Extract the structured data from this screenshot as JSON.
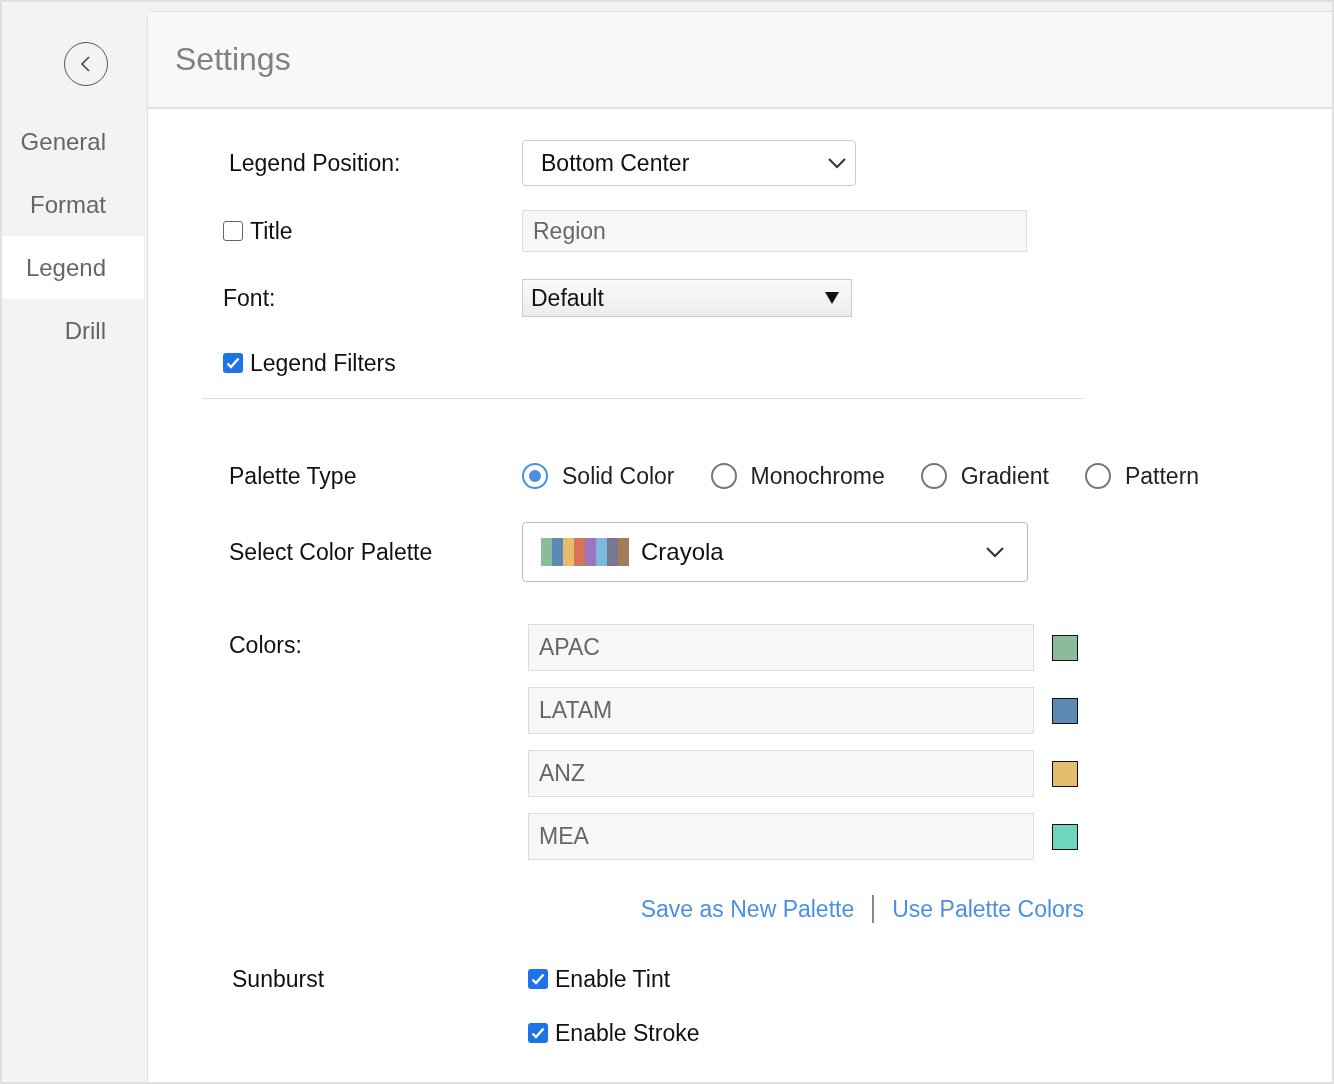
{
  "sidebar": {
    "items": [
      {
        "label": "General",
        "selected": false
      },
      {
        "label": "Format",
        "selected": false
      },
      {
        "label": "Legend",
        "selected": true
      },
      {
        "label": "Drill",
        "selected": false
      }
    ]
  },
  "header": {
    "title": "Settings"
  },
  "legend": {
    "position": {
      "label": "Legend Position:",
      "value": "Bottom Center"
    },
    "title": {
      "label": "Title",
      "checked": false,
      "value": "Region"
    },
    "font": {
      "label": "Font:",
      "value": "Default"
    },
    "legend_filters": {
      "label": "Legend Filters",
      "checked": true
    }
  },
  "palette": {
    "type_label": "Palette Type",
    "types": [
      {
        "label": "Solid Color",
        "selected": true
      },
      {
        "label": "Monochrome",
        "selected": false
      },
      {
        "label": "Gradient",
        "selected": false
      },
      {
        "label": "Pattern",
        "selected": false
      }
    ],
    "select_label": "Select Color Palette",
    "value": "Crayola",
    "colors_label": "Colors:",
    "colors": [
      {
        "name": "APAC",
        "color": "#8abb9a"
      },
      {
        "name": "LATAM",
        "color": "#5b8ab5"
      },
      {
        "name": "ANZ",
        "color": "#e4bd6c"
      },
      {
        "name": "MEA",
        "color": "#6fd5bd"
      }
    ],
    "links": [
      "Save as New Palette",
      "Use Palette Colors"
    ]
  },
  "sunburst": {
    "label": "Sunburst",
    "options": [
      {
        "label": "Enable Tint",
        "checked": true
      },
      {
        "label": "Enable Stroke",
        "checked": true
      }
    ]
  }
}
